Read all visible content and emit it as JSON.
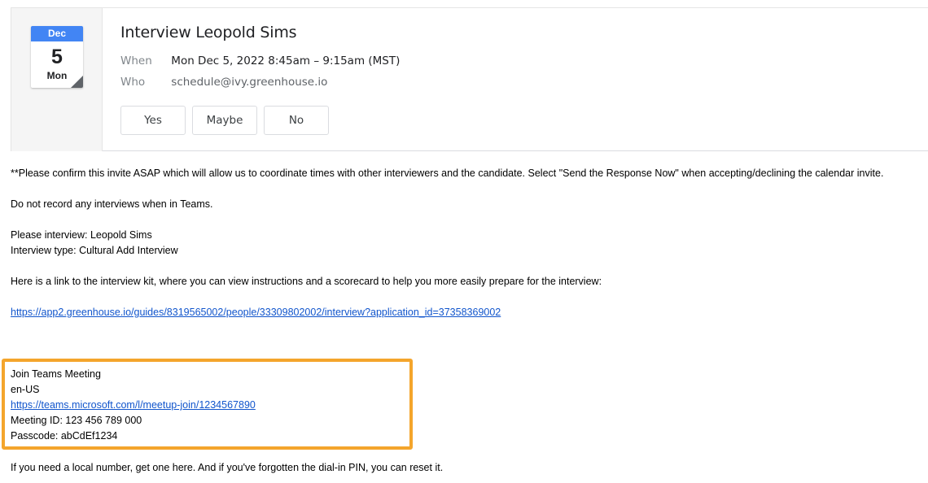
{
  "calendar": {
    "month": "Dec",
    "day": "5",
    "weekday": "Mon",
    "accent_color": "#4285f4"
  },
  "event": {
    "title": "Interview Leopold Sims",
    "when_label": "When",
    "when_value": "Mon Dec 5, 2022 8:45am – 9:15am (MST)",
    "who_label": "Who",
    "who_value": "schedule@ivy.greenhouse.io"
  },
  "rsvp": {
    "yes": "Yes",
    "maybe": "Maybe",
    "no": "No"
  },
  "body": {
    "confirm_note": "**Please confirm this invite ASAP which will allow us to coordinate times with other interviewers and the candidate. Select \"Send the Response Now\" when accepting/declining the calendar invite.",
    "no_record": "Do not record any interviews when in Teams.",
    "interview_candidate": "Please interview: Leopold Sims",
    "interview_type": "Interview type: Cultural Add Interview",
    "kit_intro": "Here is a link to the interview kit, where you can view instructions and a scorecard to help you more easily prepare for the interview:",
    "kit_link": "https://app2.greenhouse.io/guides/8319565002/people/33309802002/interview?application_id=37358369002",
    "local_number_note": "If you need a local number, get one here. And if you've forgotten the dial-in PIN, you can reset it."
  },
  "teams": {
    "heading": "Join Teams Meeting",
    "locale": "en-US",
    "link": "https://teams.microsoft.com/l/meetup-join/1234567890",
    "meeting_id": "Meeting ID: 123 456 789 000",
    "passcode": "Passcode: abCdEf1234",
    "highlight_color": "#f4a52c"
  }
}
